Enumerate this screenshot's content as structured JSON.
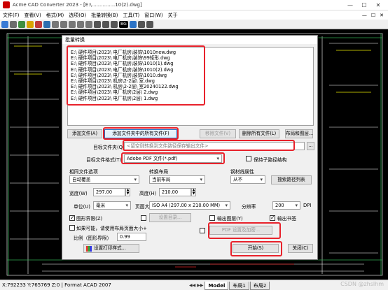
{
  "window": {
    "title": "Acme CAD Converter 2023 - [E:\\...............10(2).dwg]",
    "controls": [
      "—",
      "☐",
      "✕"
    ]
  },
  "menu": [
    "文件(F)",
    "查看(V)",
    "格式(M)",
    "选项(O)",
    "批量转换(B)",
    "工具(T)",
    "窗口(W)",
    "关于"
  ],
  "menu_right": [
    "—",
    "☐",
    "✕"
  ],
  "toolbar": {
    "bg_label": "BG"
  },
  "dialog": {
    "title": "批量转换",
    "files": [
      "E:\\          硬件项目\\2023\\          电厂机房\\装饰\\1010new.dwg",
      "E:\\          硬件项目\\2023\\          电厂机房\\装饰\\99矩形.dwg",
      "E:\\          硬件项目\\2023\\          电厂机房\\装饰\\1010(1).dwg",
      "E:\\          硬件项目\\2023\\          电厂机房\\装饰\\1010(2).dwg",
      "E:\\          硬件项目\\2023\\          电厂机房\\装饰\\1010.dwg",
      "E:\\          硬件项目\\2023\\          机房\\2-2层\\          室.dwg",
      "E:\\          硬件项目\\2023\\          机房\\2-2层\\          室20240122.dwg",
      "E:\\          硬件项目\\2023\\          电厂机房\\2层\\          2.dwg",
      "E:\\          硬件项目\\2023\\          电厂机房\\2层\\          1.dwg"
    ],
    "buttons": {
      "add_files": "添加文件(A)",
      "add_folder": "添加文件夹中的所有文件(F)",
      "remove_file": "移除文件(V)",
      "remove_all": "删除所有文件(L)",
      "layout": "布局和图层...",
      "browse": "...",
      "advanced_path": "设置目录...",
      "search_path": "搜索路径列表",
      "pdf_settings": "PDF 设置及加密...",
      "print_style": "设置打印样式...",
      "start": "开始(S)",
      "close": "关闭(C)"
    },
    "target_folder": {
      "label": "目标文件夹(Q)",
      "placeholder": "<留空则转换到文件路径保存输出文件>"
    },
    "target_format": {
      "label": "目标文件格式(T)",
      "value": "Adobe PDF 文件(*.pdf)"
    },
    "keep_subfolders": {
      "label": "保持子路径结构",
      "checked": false
    },
    "groups": {
      "relative": "相同文件选项",
      "layout": "转换布局",
      "pen": "钢材线属性"
    },
    "selects": {
      "relative": "自动覆盖",
      "layout": "当前布局",
      "pen": "从不"
    },
    "width": {
      "label": "宽度(W)",
      "value": "297.00"
    },
    "height": {
      "label": "高度(H)",
      "value": "210.00"
    },
    "unit": {
      "label": "单位(U)",
      "value": "毫米"
    },
    "page_size": {
      "label": "页面大小",
      "value": "ISO A4 (297.00 x 210.00 MM)"
    },
    "resolution": {
      "label": "分辨率",
      "value": "200",
      "unit": "DPI"
    },
    "checks": {
      "layer_bounds": {
        "label": "图形界限(Z)",
        "checked": true
      },
      "fit_page": {
        "label": "如果可能，请使用布局页面大小+",
        "checked": false
      },
      "output_layers": {
        "label": "输出图层(Y)",
        "checked": false
      },
      "output_bookmarks": {
        "label": "输出书签",
        "checked": true
      },
      "mid_checkbox": {
        "checked": false
      },
      "pdf_checkbox": {
        "checked": false
      }
    },
    "scale": {
      "label": "比例（图形界限）",
      "value": "0.99"
    }
  },
  "status": {
    "coords": "X:792233 Y:765769 Z:0 | Format ACAD 2007",
    "tabs": [
      "Model",
      "布局1",
      "布局2"
    ]
  },
  "watermark": "CSDN @zhslhm"
}
